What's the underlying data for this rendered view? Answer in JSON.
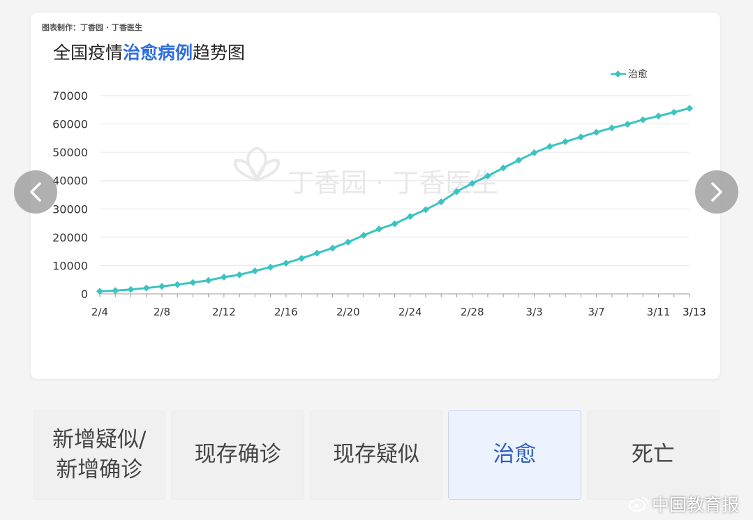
{
  "header": {
    "credit": "图表制作：丁香园 · 丁香医生",
    "title_prefix": "全国疫情",
    "title_highlight": "治愈病例",
    "title_suffix": "趋势图"
  },
  "watermark": {
    "text": "丁香园 · 丁香医生"
  },
  "colors": {
    "series": "#3cc3c1",
    "highlight": "#2f6fde",
    "active_tab": "#2f5fbf"
  },
  "chart_data": {
    "type": "line",
    "title": "全国疫情治愈病例趋势图",
    "xlabel": "",
    "ylabel": "",
    "ylim": [
      0,
      70000
    ],
    "yticks": [
      0,
      10000,
      20000,
      30000,
      40000,
      50000,
      60000,
      70000
    ],
    "xtick_labels": [
      "2/4",
      "2/8",
      "2/12",
      "2/16",
      "2/20",
      "2/24",
      "2/28",
      "3/3",
      "3/7",
      "3/11",
      "3/13"
    ],
    "grid": true,
    "legend_position": "top-right",
    "x": [
      "2/4",
      "2/5",
      "2/6",
      "2/7",
      "2/8",
      "2/9",
      "2/10",
      "2/11",
      "2/12",
      "2/13",
      "2/14",
      "2/15",
      "2/16",
      "2/17",
      "2/18",
      "2/19",
      "2/20",
      "2/21",
      "2/22",
      "2/23",
      "2/24",
      "2/25",
      "2/26",
      "2/27",
      "2/28",
      "2/29",
      "3/1",
      "3/2",
      "3/3",
      "3/4",
      "3/5",
      "3/6",
      "3/7",
      "3/8",
      "3/9",
      "3/10",
      "3/11",
      "3/12",
      "3/13"
    ],
    "series": [
      {
        "name": "治愈",
        "values": [
          892,
          1153,
          1540,
          2050,
          2649,
          3281,
          3996,
          4740,
          5911,
          6723,
          8096,
          9419,
          10844,
          12552,
          14376,
          16155,
          18264,
          20659,
          22888,
          24734,
          27323,
          29745,
          32495,
          36117,
          39002,
          41625,
          44462,
          47204,
          49856,
          52045,
          53726,
          55404,
          57065,
          58600,
          59897,
          61475,
          62793,
          64111,
          65541
        ]
      }
    ]
  },
  "nav": {
    "prev_icon": "chevron-left-icon",
    "next_icon": "chevron-right-icon"
  },
  "tabs": [
    {
      "label": "新增疑似/\n新增确诊",
      "active": false
    },
    {
      "label": "现存确诊",
      "active": false
    },
    {
      "label": "现存疑似",
      "active": false
    },
    {
      "label": "治愈",
      "active": true
    },
    {
      "label": "死亡",
      "active": false
    }
  ],
  "source_watermark": {
    "text": "中国教育报",
    "icon": "weibo-icon"
  }
}
